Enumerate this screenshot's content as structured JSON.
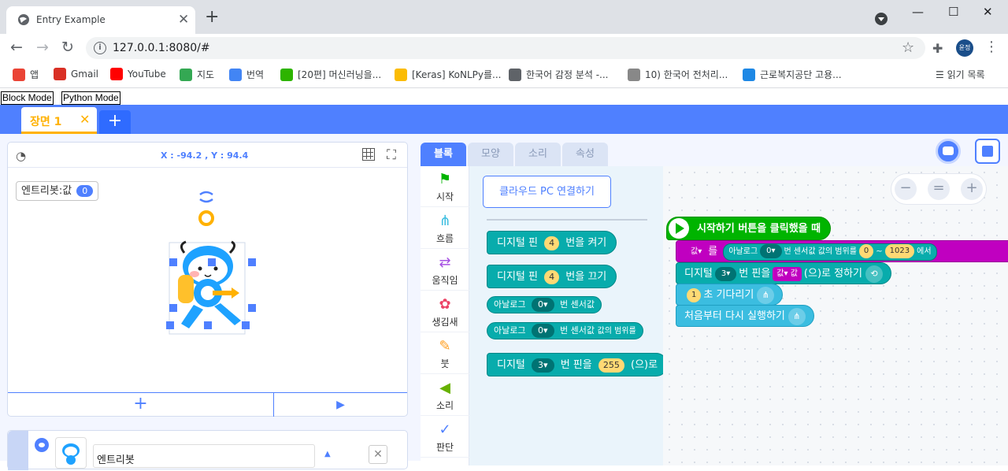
{
  "browser": {
    "tab_title": "Entry Example",
    "url": "127.0.0.1:8080/#",
    "profile_initials": "윤정",
    "bookmarks": [
      {
        "label": "앱",
        "color": "#ea4335"
      },
      {
        "label": "Gmail",
        "color": "#d93025"
      },
      {
        "label": "YouTube",
        "color": "#ff0000"
      },
      {
        "label": "지도",
        "color": "#34a853"
      },
      {
        "label": "번역",
        "color": "#4285f4"
      },
      {
        "label": "[20편] 머신러닝을...",
        "color": "#2db400"
      },
      {
        "label": "[Keras] KoNLPy를...",
        "color": "#fbbc04"
      },
      {
        "label": "한국어 감정 분석 -...",
        "color": "#5f6368"
      },
      {
        "label": "10) 한국어 전처리...",
        "color": "#888888"
      },
      {
        "label": "근로복지공단 고용...",
        "color": "#1e88e5"
      }
    ],
    "reading_list": "읽기 목록"
  },
  "modes": {
    "block": "Block Mode",
    "python": "Python Mode"
  },
  "scene": {
    "tab_label": "장면 1",
    "close": "✕",
    "add": "+"
  },
  "stage": {
    "coord": "X : -94.2 , Y : 94.4",
    "variable_name": "엔트리봇:값",
    "variable_value": "0",
    "add_label": "+",
    "run_label": "▶"
  },
  "object": {
    "name": "엔트리봇"
  },
  "block_tabs": [
    "블록",
    "모양",
    "소리",
    "속성"
  ],
  "categories": [
    {
      "label": "시작",
      "color": "#00b400",
      "glyph": "⚑"
    },
    {
      "label": "흐름",
      "color": "#3bbde0",
      "glyph": "⋔"
    },
    {
      "label": "움직임",
      "color": "#a751e3",
      "glyph": "⇄"
    },
    {
      "label": "생김새",
      "color": "#ec4466",
      "glyph": "✿"
    },
    {
      "label": "붓",
      "color": "#ff9e20",
      "glyph": "✎"
    },
    {
      "label": "소리",
      "color": "#67b100",
      "glyph": "◀"
    },
    {
      "label": "판단",
      "color": "#4f80ff",
      "glyph": "✓"
    }
  ],
  "palette": {
    "cloud_button": "클라우드 PC 연결하기",
    "blocks": [
      {
        "pre": "디지털 핀",
        "num": "4",
        "post": "번을 켜기"
      },
      {
        "pre": "디지털 핀",
        "num": "4",
        "post": "번을 끄기"
      },
      {
        "pre": "아날로그",
        "dd": "0▾",
        "post": "번 센서값"
      },
      {
        "pre": "아날로그",
        "dd": "0▾",
        "post": "번 센서값",
        "extra": "값의 범위를"
      },
      {
        "pre": "디지털",
        "dd": "3▾",
        "post": "번 핀을",
        "num": "255",
        "tail": "(으)로"
      }
    ]
  },
  "canvas": {
    "zoom": [
      "−",
      "=",
      "+"
    ],
    "start_block": "시작하기 버튼을 클릭했을 때",
    "line1": {
      "var": "값▾",
      "w1": "를",
      "p1": "아날로그",
      "dd": "0▾",
      "p2": "번 센서값",
      "w2": "값의 범위를",
      "n1": "0",
      "w3": "~",
      "n2": "1023",
      "w4": "에서"
    },
    "line2": {
      "w1": "디지털",
      "dd": "3▾",
      "w2": "번 핀을",
      "var": "값▾",
      "w3": "값",
      "w4": "(으)로 정하기"
    },
    "line3": {
      "n": "1",
      "w": "초 기다리기"
    },
    "line4": {
      "w": "처음부터 다시 실행하기"
    }
  }
}
